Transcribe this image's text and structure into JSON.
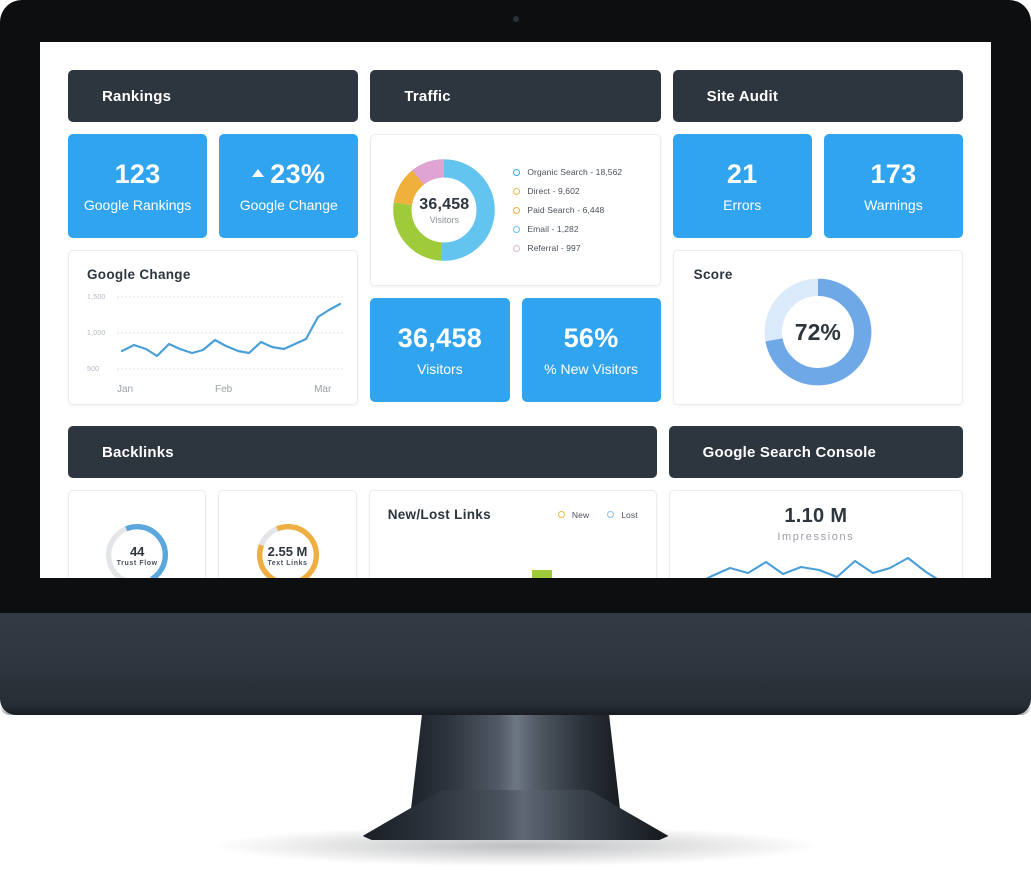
{
  "device": {
    "type": "desktop-monitor",
    "webcam": "camera-dot"
  },
  "dashboard": {
    "sections": {
      "rankings": {
        "title": "Rankings"
      },
      "traffic": {
        "title": "Traffic"
      },
      "site_audit": {
        "title": "Site Audit"
      },
      "backlinks": {
        "title": "Backlinks"
      },
      "google_search_console": {
        "title": "Google Search Console"
      }
    },
    "rankings": {
      "kpis": [
        {
          "value": "123",
          "label": "Google Rankings",
          "trend": "none"
        },
        {
          "value": "23%",
          "label": "Google Change",
          "trend": "up"
        }
      ]
    },
    "site_audit": {
      "kpis": [
        {
          "value": "21",
          "label": "Errors"
        },
        {
          "value": "173",
          "label": "Warnings"
        }
      ],
      "score": {
        "title": "Score",
        "value": "72%",
        "percent": 72
      }
    },
    "traffic": {
      "donut_center_value": "36,458",
      "donut_center_label": "Visitors",
      "kpis": [
        {
          "value": "36,458",
          "label": "Visitors"
        },
        {
          "value": "56%",
          "label": "% New Visitors"
        }
      ]
    },
    "backlinks": {
      "trust_flow": {
        "value": "44",
        "label": "Trust Flow",
        "percent": 44
      },
      "text_links": {
        "value": "2.55 M",
        "label": "Text Links",
        "percent": 86
      },
      "new_lost": {
        "title": "New/Lost Links",
        "legend": [
          {
            "label": "New",
            "color": "#e9b949"
          },
          {
            "label": "Lost",
            "color": "#8fc0e8"
          }
        ]
      }
    },
    "google_search_console": {
      "value": "1.10 M",
      "label": "Impressions"
    }
  },
  "colors": {
    "accent_blue": "#31a4f0",
    "header_dark": "#2d353e",
    "gauge_blue": "#6fa8e6",
    "gauge_track": "#dbeafb",
    "donut_blue": "#63c5ef",
    "donut_green": "#9fcb3b",
    "donut_orange": "#f0b03c",
    "donut_pink": "#dfa3d4",
    "donut_lightblue": "#8fd4f0",
    "trust_flow_blue": "#5aa7de",
    "text_links_orange": "#eeae42",
    "bar_green": "#9fcb3b",
    "sparkline_blue": "#4a9fd8"
  },
  "chart_data": [
    {
      "type": "line",
      "title": "Google Change",
      "xlabel": "",
      "ylabel": "",
      "grid": true,
      "legend": "none",
      "x": [
        "Jan",
        "Feb",
        "Mar"
      ],
      "tick_labels_x": [
        "Jan",
        "Feb",
        "Mar"
      ],
      "tick_labels_y": [
        "1,500",
        "1,000",
        "500"
      ],
      "ylim": [
        500,
        1500
      ],
      "values": [
        760,
        830,
        790,
        700,
        880,
        820,
        760,
        800,
        850,
        830,
        780,
        760,
        900,
        840,
        800,
        880,
        950,
        1180,
        1280,
        1380
      ],
      "series": [
        {
          "name": "Google Change",
          "color": "#4a9fd8",
          "values": [
            760,
            830,
            790,
            700,
            880,
            820,
            760,
            800,
            850,
            830,
            780,
            760,
            900,
            840,
            800,
            880,
            950,
            1180,
            1280,
            1380
          ]
        }
      ]
    },
    {
      "type": "pie",
      "title": "Traffic sources",
      "center_value": "36,458",
      "center_label": "Visitors",
      "total": 36458,
      "legend": "right",
      "categories": [
        "Organic Search",
        "Direct",
        "Paid Search",
        "Email",
        "Referral"
      ],
      "values": [
        18562,
        9602,
        6448,
        1282,
        997
      ],
      "labels": [
        "Organic Search - 18,562",
        "Direct - 9,602",
        "Paid Search - 6,448",
        "Email - 1,282",
        "Referral - 997"
      ],
      "colors": [
        "#63c5ef",
        "#9fcb3b",
        "#f0b03c",
        "#8fd4f0",
        "#dfa3d4"
      ],
      "legend_dot_colors": [
        "#31a4f0",
        "#e9b949",
        "#f0b03c",
        "#63c5ef",
        "#d9b8d6"
      ]
    },
    {
      "type": "pie",
      "title": "Score",
      "center_value": "72%",
      "categories": [
        "Score",
        "Remaining"
      ],
      "values": [
        72,
        28
      ],
      "colors": [
        "#6fa8e6",
        "#dbeafb"
      ]
    },
    {
      "type": "pie",
      "title": "Trust Flow",
      "center_value": "44",
      "center_label": "Trust Flow",
      "categories": [
        "Trust Flow",
        "Remaining"
      ],
      "values": [
        44,
        56
      ],
      "colors": [
        "#5aa7de",
        "#e3e5e8"
      ]
    },
    {
      "type": "pie",
      "title": "Text Links",
      "center_value": "2.55 M",
      "center_label": "Text Links",
      "categories": [
        "Text Links",
        "Remaining"
      ],
      "values": [
        86,
        14
      ],
      "colors": [
        "#eeae42",
        "#e3e5e8"
      ]
    },
    {
      "type": "bar",
      "title": "New/Lost Links",
      "legend": "top-right",
      "categories": [
        "1",
        "2",
        "3",
        "4",
        "5",
        "6",
        "7",
        "8"
      ],
      "series": [
        {
          "name": "New",
          "color": "#9fcb3b",
          "values": [
            0,
            0,
            0,
            6,
            0,
            9,
            0,
            0
          ]
        },
        {
          "name": "Lost",
          "color": "#8fc0e8",
          "values": [
            0,
            0,
            0,
            0,
            0,
            0,
            0,
            0
          ]
        }
      ],
      "ylim": [
        0,
        20
      ]
    },
    {
      "type": "line",
      "title": "Impressions",
      "value_label": "1.10 M",
      "grid": false,
      "legend": "none",
      "series": [
        {
          "name": "Impressions",
          "color": "#4a9fd8",
          "values": [
            14,
            22,
            30,
            26,
            34,
            24,
            30,
            28,
            22,
            34,
            24,
            28,
            36,
            26,
            18
          ]
        }
      ]
    }
  ]
}
